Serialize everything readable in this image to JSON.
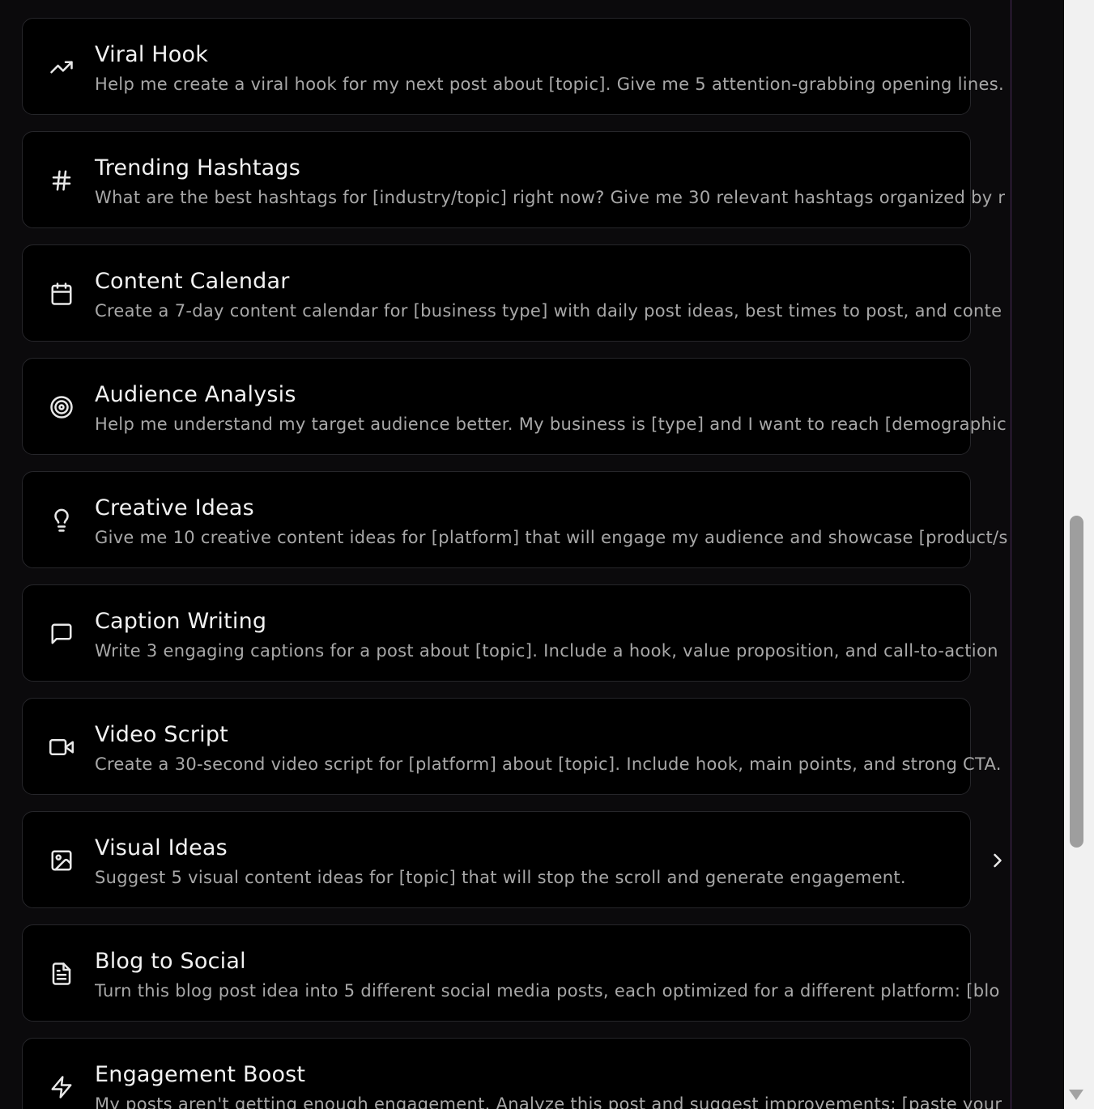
{
  "prompts": [
    {
      "icon": "trending-up-icon",
      "title": "Viral Hook",
      "description": "Help me create a viral hook for my next post about [topic]. Give me 5 attention-grabbing opening lines."
    },
    {
      "icon": "hash-icon",
      "title": "Trending Hashtags",
      "description": "What are the best hashtags for [industry/topic] right now? Give me 30 relevant hashtags organized by r"
    },
    {
      "icon": "calendar-icon",
      "title": "Content Calendar",
      "description": "Create a 7-day content calendar for [business type] with daily post ideas, best times to post, and conte"
    },
    {
      "icon": "target-icon",
      "title": "Audience Analysis",
      "description": "Help me understand my target audience better. My business is [type] and I want to reach [demographic"
    },
    {
      "icon": "lightbulb-icon",
      "title": "Creative Ideas",
      "description": "Give me 10 creative content ideas for [platform] that will engage my audience and showcase [product/s"
    },
    {
      "icon": "message-square-icon",
      "title": "Caption Writing",
      "description": "Write 3 engaging captions for a post about [topic]. Include a hook, value proposition, and call-to-action"
    },
    {
      "icon": "video-icon",
      "title": "Video Script",
      "description": "Create a 30-second video script for [platform] about [topic]. Include hook, main points, and strong CTA."
    },
    {
      "icon": "image-icon",
      "title": "Visual Ideas",
      "description": "Suggest 5 visual content ideas for [topic] that will stop the scroll and generate engagement."
    },
    {
      "icon": "file-text-icon",
      "title": "Blog to Social",
      "description": "Turn this blog post idea into 5 different social media posts, each optimized for a different platform: [blo"
    },
    {
      "icon": "zap-icon",
      "title": "Engagement Boost",
      "description": "My posts aren't getting enough engagement. Analyze this post and suggest improvements: [paste your"
    }
  ],
  "chevron_icon": "chevron-right-icon",
  "colors": {
    "background": "#0b0a0c",
    "card": "#000000",
    "card_border": "#26262a",
    "title": "#f2f2f2",
    "description": "#a8a8a8",
    "divider_accent": "#4a2a5a"
  }
}
